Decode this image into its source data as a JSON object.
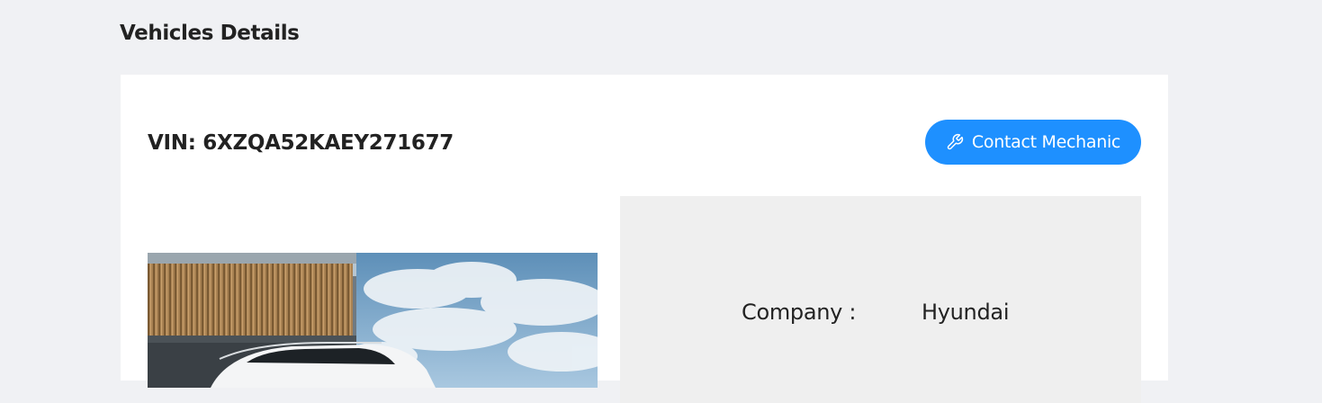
{
  "page": {
    "title": "Vehicles Details"
  },
  "vehicle": {
    "vin_label": "VIN: 6XZQA52KAEY271677",
    "contact_button": {
      "label": "Contact Mechanic",
      "icon": "wrench-icon"
    },
    "details": [
      {
        "label": "Company :",
        "value": "Hyundai"
      }
    ]
  },
  "colors": {
    "background": "#f0f1f4",
    "card": "#ffffff",
    "accent": "#1e90ff",
    "details_panel": "#efefef"
  }
}
